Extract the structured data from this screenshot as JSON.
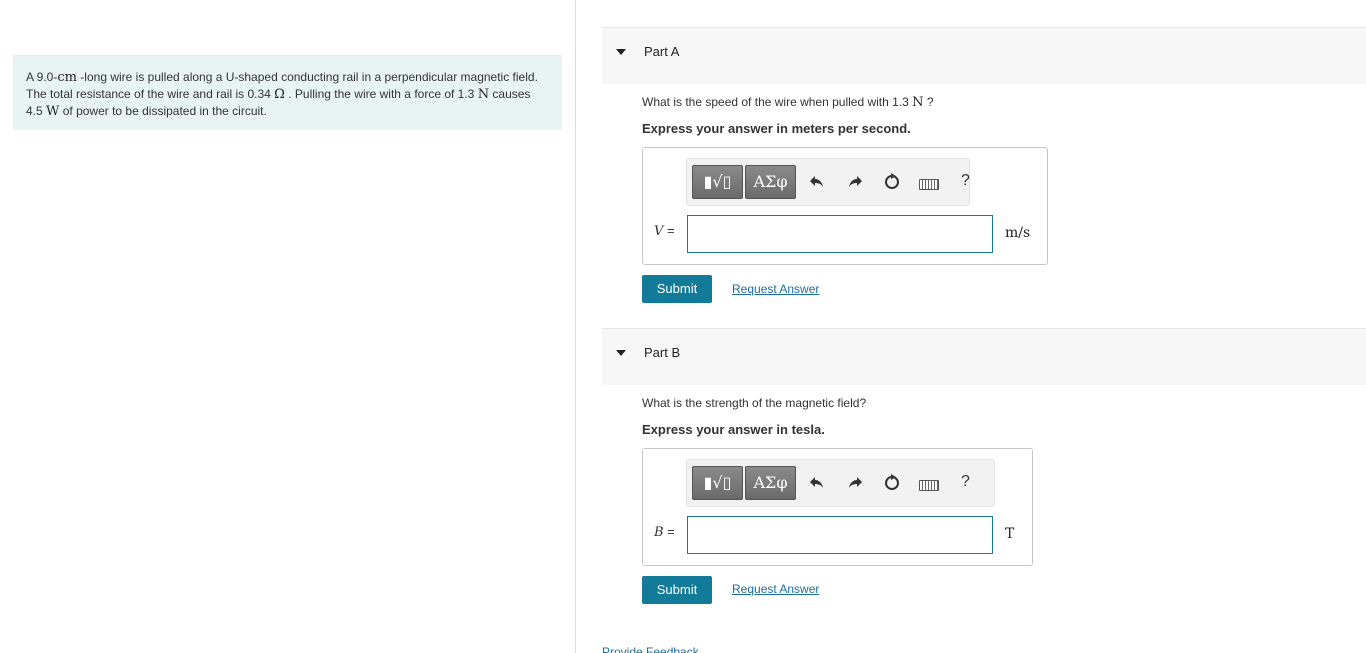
{
  "problem": {
    "t1": "A 9.0-",
    "u1": "cm",
    "t2": " -long wire is pulled along a U-shaped conducting rail in a perpendicular magnetic field. The total resistance of the wire and rail is 0.34 ",
    "u2": "Ω",
    "t3": " . Pulling the wire with a force of 1.3 ",
    "u3": "N",
    "t4": " causes 4.5 ",
    "u4": "W",
    "t5": " of power to be dissipated in the circuit."
  },
  "parts": [
    {
      "title": "Part A",
      "question_prefix": "What is the speed of the wire when pulled with 1.3 ",
      "question_unit": "N",
      "question_suffix": " ?",
      "instruction": "Express your answer in meters per second.",
      "templates_label": "▮√▯",
      "symbols_label": "ΑΣφ",
      "help_label": "?",
      "variable": "V",
      "equals": " =",
      "unit": "m/s",
      "input_value": "",
      "submit_label": "Submit",
      "request_label": "Request Answer",
      "icons": [
        "templates-icon",
        "symbols-icon",
        "undo-icon",
        "redo-icon",
        "reset-icon",
        "keyboard-icon",
        "help-icon"
      ]
    },
    {
      "title": "Part B",
      "question_prefix": "What is the strength of the magnetic field?",
      "question_unit": "",
      "question_suffix": "",
      "instruction": "Express your answer in tesla.",
      "templates_label": "▮√▯",
      "symbols_label": "ΑΣφ",
      "help_label": "?",
      "variable": "B",
      "equals": " =",
      "unit": "T",
      "input_value": "",
      "submit_label": "Submit",
      "request_label": "Request Answer",
      "icons": [
        "templates-icon",
        "symbols-icon",
        "undo-icon",
        "redo-icon",
        "reset-icon",
        "keyboard-icon",
        "help-icon"
      ]
    }
  ],
  "feedback_label": "Provide Feedback",
  "colors": {
    "submit": "#137b9a",
    "link": "#1a6fa0",
    "problem_bg": "#e8f4f4",
    "input_border": "#1a7a96"
  }
}
